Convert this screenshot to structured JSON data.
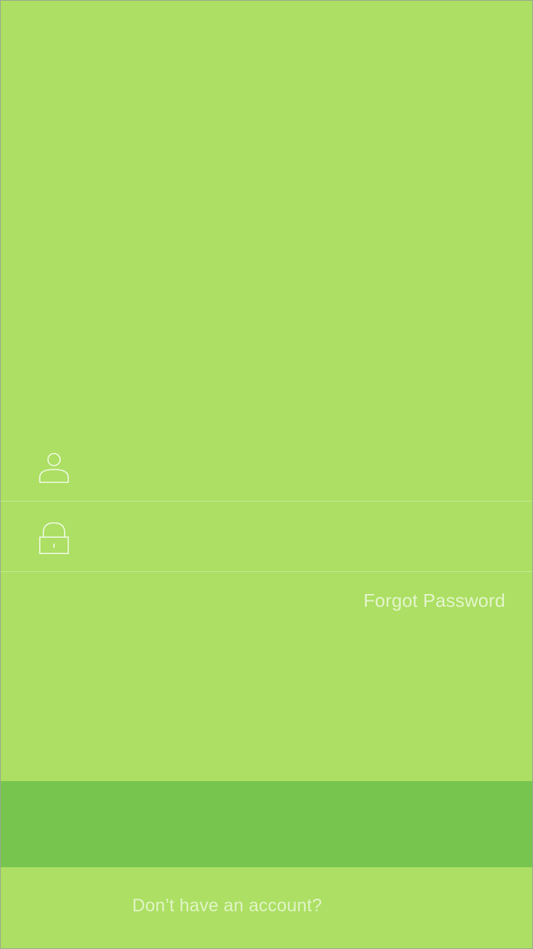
{
  "login": {
    "username": {
      "value": "",
      "placeholder": "",
      "icon": "user-icon"
    },
    "password": {
      "value": "",
      "placeholder": "",
      "icon": "lock-icon"
    },
    "forgot_password_label": "Forgot Password",
    "primary_button_label": "",
    "signup_prompt": "Don’t have an account?"
  },
  "colors": {
    "background": "#acdf63",
    "primary_button": "#77c54e",
    "text": "#f0fae4",
    "divider": "#c8ea9c"
  }
}
